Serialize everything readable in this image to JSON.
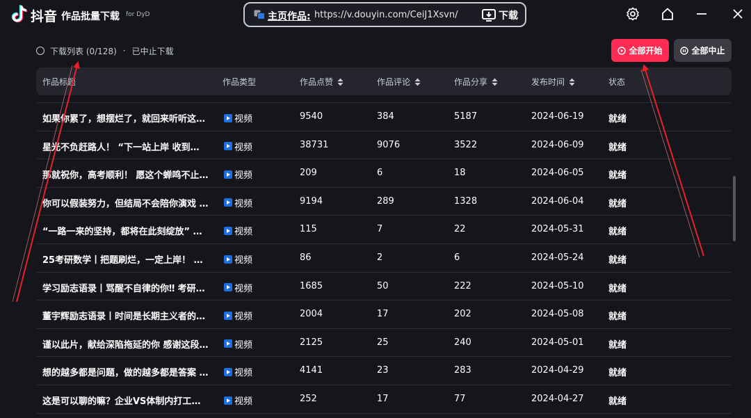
{
  "app": {
    "name": "抖音",
    "subtitle": "作品批量下载",
    "for_text": "for DyD"
  },
  "urlbar": {
    "label": "主页作品:",
    "value": "https://v.douyin.com/CeiJ1Xsvn/",
    "download_label": "下载"
  },
  "window_controls": [
    "gear-icon",
    "home-icon",
    "minimize-icon",
    "close-icon"
  ],
  "status": {
    "list_text": "下载列表 (0/128)",
    "separator": "·",
    "state_text": "已中止下载"
  },
  "actions": {
    "start_all": "全部开始",
    "stop_all": "全部中止"
  },
  "columns": {
    "title": "作品标题",
    "type": "作品类型",
    "likes": "作品点赞",
    "comments": "作品评论",
    "shares": "作品分享",
    "date": "发布时间",
    "status": "状态"
  },
  "rows": [
    {
      "title": "如果你累了，想摆烂了，就回来听听这…",
      "type": "视频",
      "likes": "9540",
      "comments": "384",
      "shares": "5187",
      "date": "2024-06-19",
      "status": "就绪"
    },
    {
      "title": "星光不负赶路人！ “下一站上岸 收到…",
      "type": "视频",
      "likes": "38731",
      "comments": "9076",
      "shares": "3522",
      "date": "2024-06-09",
      "status": "就绪"
    },
    {
      "title": "那就祝你，高考顺利！ 愿这个蝉鸣不止…",
      "type": "视频",
      "likes": "209",
      "comments": "6",
      "shares": "18",
      "date": "2024-06-05",
      "status": "就绪"
    },
    {
      "title": "你可以假装努力，但结局不会陪你演戏 …",
      "type": "视频",
      "likes": "9194",
      "comments": "289",
      "shares": "1328",
      "date": "2024-06-04",
      "status": "就绪"
    },
    {
      "title": "“一路一来的坚持，都将在此刻绽放” …",
      "type": "视频",
      "likes": "115",
      "comments": "7",
      "shares": "22",
      "date": "2024-05-31",
      "status": "就绪"
    },
    {
      "title": "25考研数学丨把题刷烂，一定上岸！ …",
      "type": "视频",
      "likes": "86",
      "comments": "2",
      "shares": "6",
      "date": "2024-05-24",
      "status": "就绪"
    },
    {
      "title": "学习励志语录丨骂醒不自律的你‼ 考研…",
      "type": "视频",
      "likes": "1685",
      "comments": "50",
      "shares": "222",
      "date": "2024-05-10",
      "status": "就绪"
    },
    {
      "title": "董宇辉励志语录丨时间是长期主义者的…",
      "type": "视频",
      "likes": "2004",
      "comments": "17",
      "shares": "202",
      "date": "2024-05-08",
      "status": "就绪"
    },
    {
      "title": "谨以此片，献给深陷拖延的你 感谢这段…",
      "type": "视频",
      "likes": "2125",
      "comments": "25",
      "shares": "240",
      "date": "2024-05-01",
      "status": "就绪"
    },
    {
      "title": "想的越多都是问题，做的越多都是答案 …",
      "type": "视频",
      "likes": "4141",
      "comments": "23",
      "shares": "283",
      "date": "2024-04-29",
      "status": "就绪"
    },
    {
      "title": "这是可以聊的嘛？企业VS体制内打工人…",
      "type": "视频",
      "likes": "252",
      "comments": "17",
      "shares": "77",
      "date": "2024-04-27",
      "status": "就绪"
    }
  ],
  "colors": {
    "background": "#15161c",
    "accent": "#fe2c55",
    "annotation": "#e8202a"
  }
}
